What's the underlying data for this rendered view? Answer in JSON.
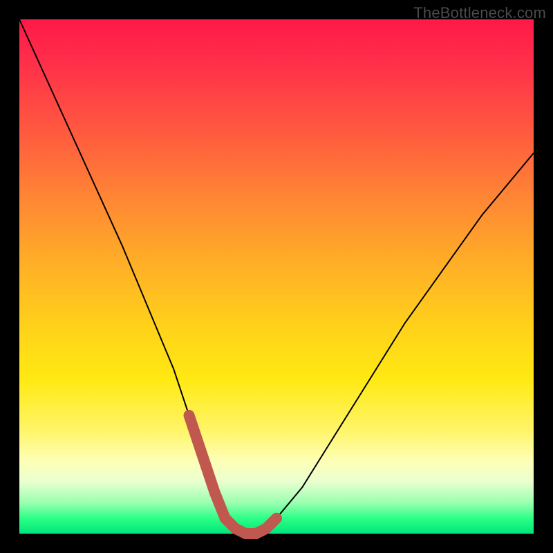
{
  "watermark": "TheBottleneck.com",
  "colors": {
    "frame": "#000000",
    "curve_thin": "#000000",
    "curve_thick": "#c1584f"
  },
  "chart_data": {
    "type": "line",
    "title": "",
    "xlabel": "",
    "ylabel": "",
    "xlim": [
      0,
      100
    ],
    "ylim": [
      0,
      100
    ],
    "series": [
      {
        "name": "bottleneck-curve",
        "x": [
          0,
          5,
          10,
          15,
          20,
          25,
          30,
          33,
          36,
          38,
          40,
          42,
          44,
          46,
          48,
          50,
          55,
          60,
          65,
          70,
          75,
          80,
          85,
          90,
          95,
          100
        ],
        "y": [
          100,
          89,
          78,
          67,
          56,
          44,
          32,
          23,
          14,
          8,
          3,
          1,
          0,
          0,
          1,
          3,
          9,
          17,
          25,
          33,
          41,
          48,
          55,
          62,
          68,
          74
        ]
      }
    ],
    "highlight": {
      "x_range": [
        33,
        50
      ],
      "note": "optimal-region"
    }
  }
}
